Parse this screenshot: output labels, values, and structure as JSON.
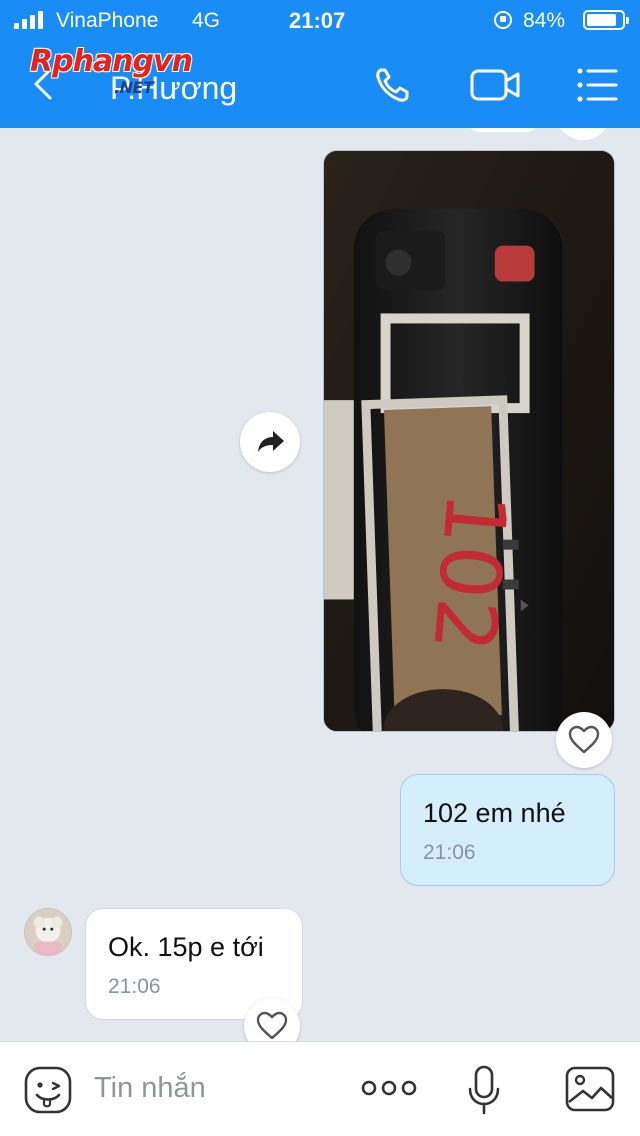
{
  "status_bar": {
    "carrier": "VinaPhone",
    "network": "4G",
    "time": "21:07",
    "battery_percent": "84%",
    "battery_level": 0.84,
    "signal_icon": "signal-bars-icon",
    "lock_icon": "rotation-lock-icon"
  },
  "header": {
    "title": "P.Hương",
    "watermark": "Rphangvn",
    "watermark_sub": ".NET",
    "back_icon": "chevron-left-icon",
    "call_icon": "phone-icon",
    "video_icon": "video-camera-icon",
    "menu_icon": "menu-list-icon"
  },
  "messages": [
    {
      "direction": "out",
      "type": "image",
      "reaction_icon": "heart-icon",
      "forward_icon": "share-arrow-icon"
    },
    {
      "direction": "out",
      "type": "text",
      "text": "102 em nhé",
      "time": "21:06"
    },
    {
      "direction": "in",
      "type": "text",
      "text": "Ok. 15p e tới",
      "time": "21:06",
      "reaction_icon": "heart-icon",
      "avatar_icon": "contact-avatar"
    }
  ],
  "composer": {
    "placeholder": "Tin nhắn",
    "sticker_icon": "sticker-face-icon",
    "more_icon": "more-dots-icon",
    "mic_icon": "microphone-icon",
    "image_icon": "photo-gallery-icon"
  },
  "colors": {
    "header_blue": "#1a8cf5",
    "chat_background": "#e3e8ef",
    "outgoing_bubble": "#d5eefc",
    "incoming_bubble": "#ffffff",
    "watermark_red": "#e5231b"
  }
}
